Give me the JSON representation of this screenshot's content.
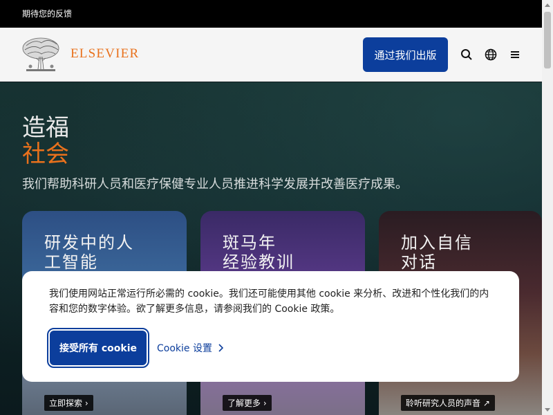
{
  "topbar": {
    "feedback_label": "期待您的反馈"
  },
  "header": {
    "logo_text": "ELSEVIER",
    "publish_label": "通过我们出版",
    "icons": [
      "search-icon",
      "globe-icon",
      "menu-icon"
    ]
  },
  "hero": {
    "title_line1": "造福",
    "title_line2": "社会",
    "subtitle": "我们帮助科研人员和医疗保健专业人员推进科学发展并改善医疗成果。"
  },
  "cards": [
    {
      "title_line1": "研发中的人",
      "title_line2": "工智能",
      "link": "立即探索"
    },
    {
      "title_line1": "斑马年",
      "title_line2": "经验教训",
      "link": "了解更多"
    },
    {
      "title_line1": "加入自信",
      "title_line2": "对话",
      "link": "聆听研究人员的声音"
    }
  ],
  "cookie": {
    "text": "我们使用网站正常运行所必需的 cookie。我们还可能使用其他 cookie 来分析、改进和个性化我们的内容和您的数字体验。欲了解更多信息，请参阅我们的 Cookie 政策。",
    "accept_label": "接受所有 cookie",
    "settings_label": "Cookie 设置"
  },
  "colors": {
    "brand_orange": "#e9711c",
    "brand_blue": "#0c3e9c"
  }
}
